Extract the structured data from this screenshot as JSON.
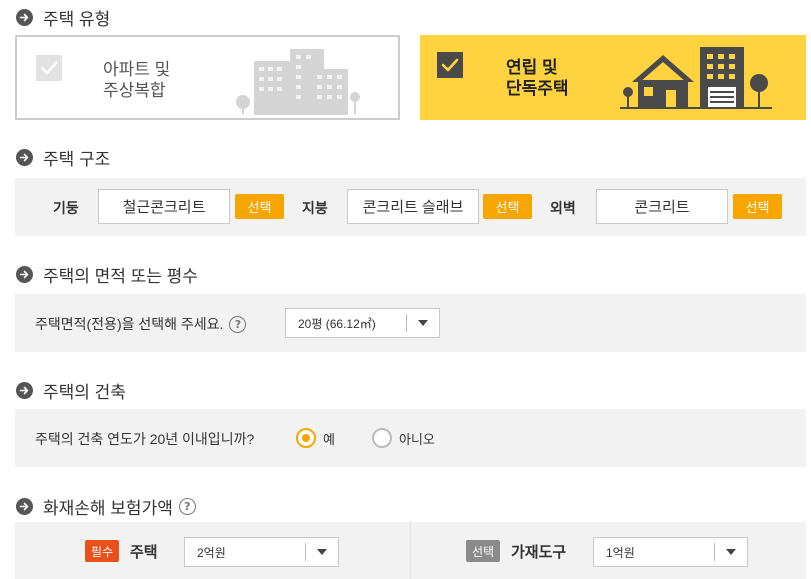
{
  "sections": {
    "type": {
      "title": "주택 유형"
    },
    "structure": {
      "title": "주택 구조"
    },
    "area": {
      "title": "주택의 면적 또는 평수"
    },
    "build": {
      "title": "주택의 건축"
    },
    "insurance": {
      "title": "화재손해 보험가액"
    }
  },
  "housing_types": [
    {
      "line1": "아파트 및",
      "line2": "주상복합",
      "selected": false
    },
    {
      "line1": "연립 및",
      "line2": "단독주택",
      "selected": true
    }
  ],
  "structure": {
    "pillar": {
      "label": "기둥",
      "value": "철근콘크리트",
      "button": "선택"
    },
    "roof": {
      "label": "지붕",
      "value": "콘크리트 슬래브",
      "button": "선택"
    },
    "wall": {
      "label": "외벽",
      "value": "콘크리트",
      "button": "선택"
    }
  },
  "area": {
    "question": "주택면적(전용)을 선택해 주세요.",
    "help": "?",
    "selected": "20평 (66.12㎡)"
  },
  "build": {
    "question": "주택의 건축 연도가 20년 이내입니까?",
    "options": [
      {
        "label": "예",
        "selected": true
      },
      {
        "label": "아니오",
        "selected": false
      }
    ]
  },
  "insurance": {
    "help": "?",
    "house": {
      "badge": "필수",
      "label": "주택",
      "value": "2억원"
    },
    "furniture": {
      "badge": "선택",
      "label": "가재도구",
      "value": "1억원"
    }
  },
  "colors": {
    "accent": "#f7a600",
    "selected_card": "#ffd33f",
    "required_badge": "#e8511c",
    "panel_bg": "#f2f2f2"
  },
  "icons": [
    "arrow-right-circle-icon",
    "checkbox-icon",
    "apartment-building-icon",
    "house-icon",
    "help-icon",
    "chevron-down-icon"
  ]
}
